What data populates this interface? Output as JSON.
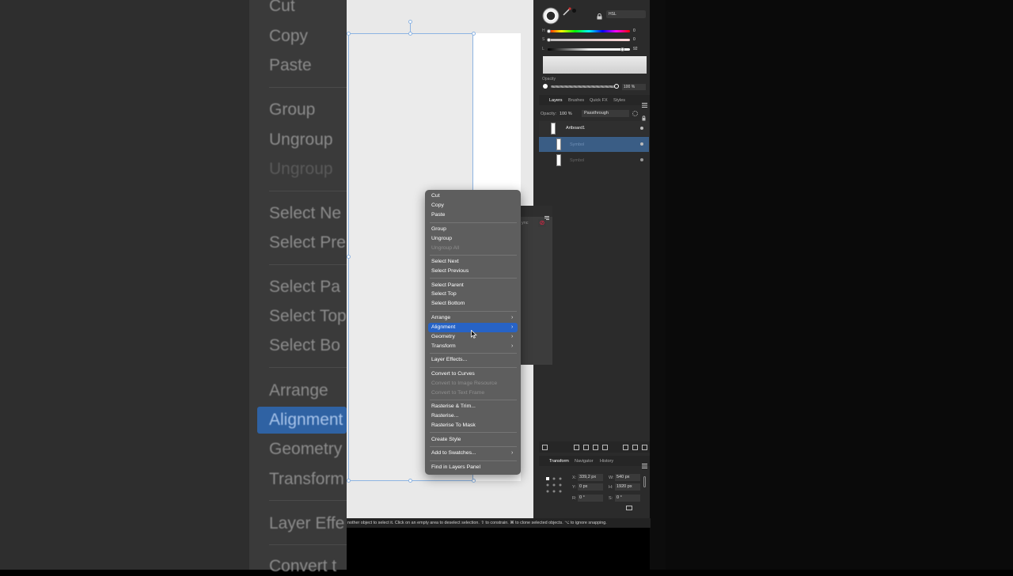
{
  "background_menu": {
    "items": [
      "Cut",
      "Copy",
      "Paste",
      "Group",
      "Ungroup",
      "Ungroup All",
      "Select Next",
      "Select Previous",
      "Select Parent",
      "Select Top",
      "Select Bottom",
      "Arrange",
      "Alignment",
      "Geometry",
      "Transform",
      "Layer Effects",
      "Convert to"
    ],
    "visible_fragments": [
      "Cut",
      "Copy",
      "Paste",
      "Group",
      "Ungroup",
      "Ungroup",
      "Select Ne",
      "Select Pre",
      "Select Pa",
      "Select Top",
      "Select Bo",
      "Arrange",
      "Alignment",
      "Geometry",
      "Transform",
      "Layer Effe",
      "Convert t"
    ]
  },
  "color_panel": {
    "model": "HSL",
    "h_label": "H",
    "s_label": "S",
    "l_label": "L",
    "h_value": "0",
    "s_value": "0",
    "l_value": "92",
    "opacity_label": "Opacity",
    "opacity_value": "100 %"
  },
  "layers_panel": {
    "tabs": [
      "Layers",
      "Brushes",
      "Quick FX",
      "Styles"
    ],
    "opacity_label": "Opacity:",
    "opacity_value": "100 %",
    "blend_mode": "Passthrough",
    "layers": [
      {
        "name": "Artboard1"
      },
      {
        "name": "Symbol"
      },
      {
        "name": "Symbol"
      }
    ]
  },
  "transform_panel": {
    "tabs": [
      "Transform",
      "Navigator",
      "History"
    ],
    "x_label": "X:",
    "x_value": "339,2 px",
    "y_label": "Y:",
    "y_value": "0 px",
    "w_label": "W:",
    "w_value": "540 px",
    "h_label": "H:",
    "h_value": "1920 px",
    "r_label": "R:",
    "r_value": "0 °",
    "s_label": "S:",
    "s_value": "0 °"
  },
  "symbols_fragment": "ync",
  "context_menu": {
    "items": [
      {
        "label": "Cut"
      },
      {
        "label": "Copy"
      },
      {
        "label": "Paste"
      },
      {
        "label": "Group"
      },
      {
        "label": "Ungroup"
      },
      {
        "label": "Ungroup All",
        "disabled": true
      },
      {
        "label": "Select Next"
      },
      {
        "label": "Select Previous"
      },
      {
        "label": "Select Parent"
      },
      {
        "label": "Select Top"
      },
      {
        "label": "Select Bottom"
      },
      {
        "label": "Arrange",
        "submenu": true
      },
      {
        "label": "Alignment",
        "submenu": true,
        "highlighted": true
      },
      {
        "label": "Geometry",
        "submenu": true
      },
      {
        "label": "Transform",
        "submenu": true
      },
      {
        "label": "Layer Effects..."
      },
      {
        "label": "Convert to Curves"
      },
      {
        "label": "Convert to Image Resource",
        "disabled": true
      },
      {
        "label": "Convert to Text Frame",
        "disabled": true
      },
      {
        "label": "Rasterise & Trim..."
      },
      {
        "label": "Rasterise..."
      },
      {
        "label": "Rasterise To Mask"
      },
      {
        "label": "Create Style"
      },
      {
        "label": "Add to Swatches...",
        "submenu": true
      },
      {
        "label": "Find in Layers Panel"
      }
    ]
  },
  "status_bar": {
    "text": "nother object to select it. Click on an empty area to deselect selection. ⇧ to constrain. ⌘ to clone selected objects. ⌥ to ignore snapping."
  },
  "icons": [
    "swatch-icon",
    "eyedropper-icon",
    "lock-icon",
    "menu-icon",
    "visibility-icon",
    "gear-icon",
    "cursor-icon",
    "chevron-right-icon"
  ],
  "colors": {
    "highlight": "#2763c6",
    "menu_bg": "#5e5e5e",
    "selection_blue": "#8db4e2",
    "layer_selected": "#3a5d85"
  }
}
